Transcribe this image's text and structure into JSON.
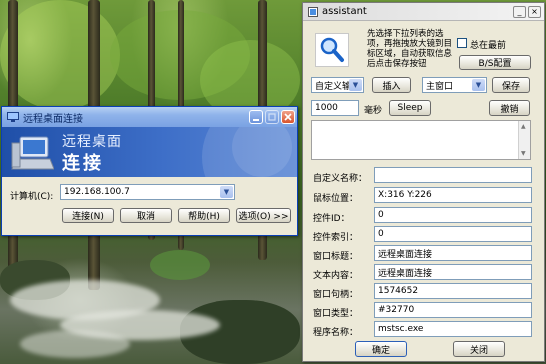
{
  "assistant": {
    "title": "assistant",
    "buttons": {
      "minimize": "_",
      "close": "×"
    },
    "instruction": "先选择下拉列表的选项，再拖拽放大镜到目标区域，自动获取信息后点击保存按钮",
    "always_on_top_label": "总在最前",
    "bs_config_label": "B/S配置",
    "mode_select": "自定义输",
    "insert_label": "插入",
    "window_select": "主窗口",
    "save_label": "保存",
    "delay_value": "1000",
    "ms_label": "毫秒",
    "sleep_label": "Sleep",
    "undo_label": "撤销",
    "form": {
      "custom_name_label": "自定义名称：",
      "custom_name_value": "",
      "mouse_pos_label": "鼠标位置：",
      "mouse_pos_value": "X:316 Y:226",
      "control_id_label": "控件ID：",
      "control_id_value": "0",
      "control_index_label": "控件索引：",
      "control_index_value": "0",
      "window_title_label": "窗口标题：",
      "window_title_value": "远程桌面连接",
      "text_content_label": "文本内容：",
      "text_content_value": "远程桌面连接",
      "window_handle_label": "窗口句柄：",
      "window_handle_value": "1574652",
      "window_class_label": "窗口类型：",
      "window_class_value": "#32770",
      "program_name_label": "程序名称：",
      "program_name_value": "mstsc.exe"
    },
    "ok_label": "确定",
    "close_label": "关闭"
  },
  "rdp": {
    "title": "远程桌面连接",
    "banner_line1": "远程桌面",
    "banner_line2": "连接",
    "computer_label": "计算机(C):",
    "computer_value": "192.168.100.7",
    "connect_label": "连接(N)",
    "cancel_label": "取消",
    "help_label": "帮助(H)",
    "options_label": "选项(O) >>"
  }
}
